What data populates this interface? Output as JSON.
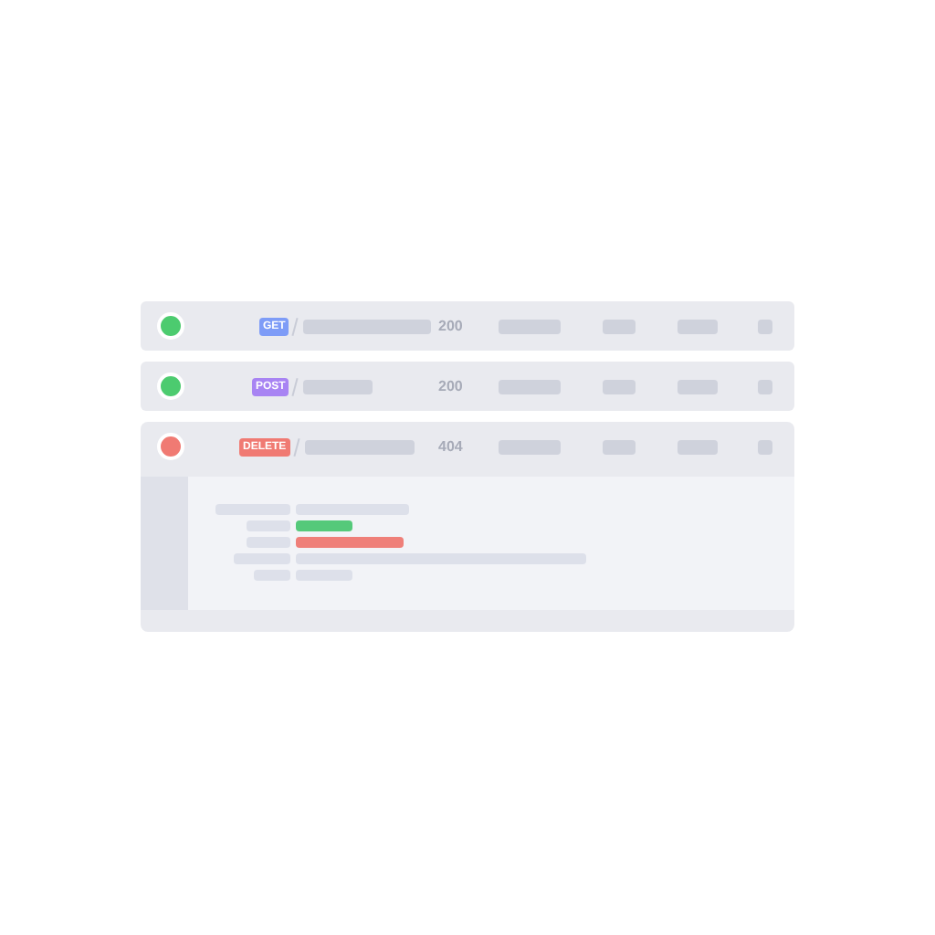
{
  "requests": [
    {
      "method": {
        "text": "GET",
        "color": "#7e9cf7"
      },
      "status": "200",
      "color": "#4ccb6f",
      "expanded": false
    },
    {
      "method": {
        "text": "POST",
        "color": "#a884f3"
      },
      "status": "200",
      "color": "#4ccb6f",
      "expanded": false
    },
    {
      "method": {
        "text": "DELETE",
        "color": "#f07a73"
      },
      "status": "404",
      "color": "#f07a73",
      "expanded": true
    }
  ],
  "details": [
    {
      "kind": "plain"
    },
    {
      "kind": "success"
    },
    {
      "kind": "error"
    },
    {
      "kind": "plain"
    },
    {
      "kind": "plain"
    }
  ]
}
